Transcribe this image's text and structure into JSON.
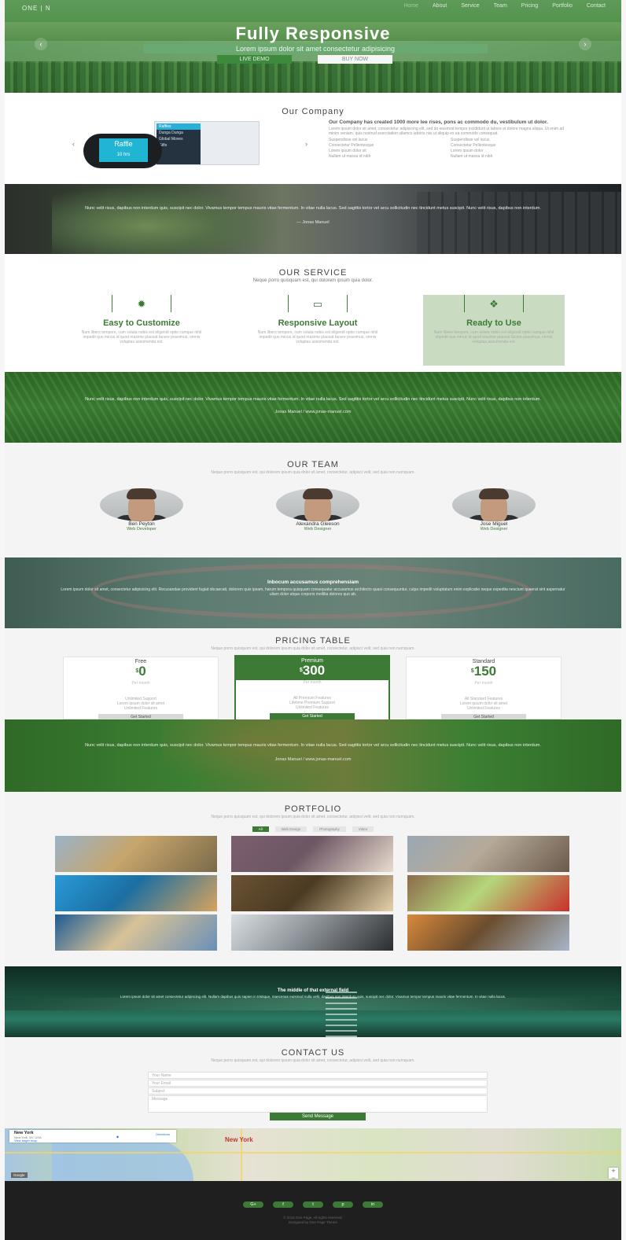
{
  "nav": {
    "brand": "ONE | N",
    "items": [
      "Home",
      "About",
      "Service",
      "Team",
      "Pricing",
      "Portfolio",
      "Contact"
    ],
    "active_index": 0
  },
  "hero": {
    "title": "Fully Responsive",
    "subtitle": "Lorem ipsum dolor sit amet consectetur adipisicing",
    "btn_demo": "LIVE DEMO",
    "btn_buy": "BUY NOW",
    "prev_icon": "‹",
    "next_icon": "›"
  },
  "company": {
    "title": "Our Company",
    "heading": "Our Company has created 1000 more lee rises, pons ac commodo du, vestibulum ut dolor.",
    "body": "Lorem ipsum dolor sit amet, consectetur adipisicing elit, sed do eiusmod tempor incididunt ut labore et dolore magna aliqua. Ut enim ad minim veniam, quis nostrud exercitation ullamco laboris nisi ut aliquip ex ea commodo consequat.",
    "list": [
      "Suspendisse vel lacus",
      "Suspendisse vel lacus",
      "Consectetur Pellentesque",
      "Consectetur Pellentesque",
      "Lorem ipsum dolor sit",
      "Lorem ipsum dolor",
      "Nullam ut massa id nibh",
      "Nullam ut massa id nibh"
    ],
    "phone_menu": [
      "Raffles",
      "Dunga Dunga",
      "Global Moves",
      "Gifts"
    ],
    "watch_label": "Raffle",
    "watch_sub": "10 hrs",
    "prev": "‹",
    "next": "›"
  },
  "quote1": {
    "text": "Nunc velit risus, dapibus non interdum quis, suscipit nec dolor. Vivamus tempor tempus mauris vitae fermentum. In vitae nulla lacus. Sed sagittis tortor vel arcu sollicitudin nec tincidunt metus suscipit. Nunc velit risus, dapibus non interdum.",
    "author": "— Jonas Manuel"
  },
  "service": {
    "title": "OUR SERVICE",
    "subtitle": "Neque porro quisquam est, qui dolorem ipsum quia dolor.",
    "items": [
      {
        "icon": "gear-icon",
        "glyph": "✹",
        "title": "Easy to Customize",
        "text": "Nam libero tempore, cum soluta nobis est eligendi optio cumque nihil impedit quo minus id quod maxime placeat facere possimus, omnis voluptas assumenda est."
      },
      {
        "icon": "monitor-icon",
        "glyph": "▭",
        "title": "Responsive Layout",
        "text": "Nam libero tempore, cum soluta nobis est eligendi optio cumque nihil impedit quo minus id quod maxime placeat facere possimus, omnis voluptas assumenda est."
      },
      {
        "icon": "dropbox-icon",
        "glyph": "❖",
        "title": "Ready to Use",
        "text": "Nam libero tempore, cum soluta nobis est eligendi optio cumque nihil impedit quo minus id quod maxime placeat facere possimus, omnis voluptas assumenda est."
      }
    ]
  },
  "quote2": {
    "text": "Nunc velit risus, dapibus non interdum quis, suscipit nec dolor. Vivamus tempor tempus mauris vitae fermentum. In vitae nulla lacus. Sed sagittis tortor vel arcu sollicitudin nec tincidunt metus suscipit. Nunc velit risus, dapibus non interdum.",
    "author": "Jonas Manuel / www.jonas-manuel.com"
  },
  "team": {
    "title": "OUR TEAM",
    "subtitle": "Neque porro quisquam est, qui dolorem ipsum quia dolor sit amet, consectetur, adipisci velit, sed quia non numquam.",
    "members": [
      {
        "name": "Ben Peyton",
        "role": "Web Developer"
      },
      {
        "name": "Alexandra Gleeson",
        "role": "Web Designer"
      },
      {
        "name": "Jose Miguel",
        "role": "Web Designer"
      }
    ]
  },
  "info": {
    "title": "Inbocum accusamus comprehensiam",
    "text": "Lorem ipsum dolor sit amet, consectetur adipisicing elit. Recusandae provident fugiat obcaecati, dolorem quis ipsam, harum tempora quisquam consequatur accusamus architecto quasi consequuntur, culpa impedit voluptatum enim explicabo neque expedita nesciunt quaerat sint aspernatur ullam dolor atque corporis mollitia dolores quo ab."
  },
  "pricing": {
    "title": "PRICING TABLE",
    "subtitle": "Neque porro quisquam est, qui dolorem ipsum quia dolor sit amet, consectetur, adipisci velit, sed quia non numquam.",
    "currency": "$",
    "plans": [
      {
        "name": "Free",
        "price": "0",
        "desc": "Per month",
        "features": "Unlimited Support\nLorem ipsum dolor sit amet\nUnlimited Features",
        "button": "Get Started",
        "featured": false
      },
      {
        "name": "Premium",
        "price": "300",
        "desc": "Per month",
        "features": "All Premium Features\nLifetime Premium Support\nUnlimited Features",
        "button": "Get Started",
        "featured": true
      },
      {
        "name": "Standard",
        "price": "150",
        "desc": "Per month",
        "features": "All Standard Features\nLorem ipsum dolor sit amet\nUnlimited Features",
        "button": "Get Started",
        "featured": false
      }
    ]
  },
  "quote3": {
    "text": "Nunc velit risus, dapibus non interdum quis, suscipit nec dolor. Vivamus tempor tempus mauris vitae fermentum. In vitae nulla lacus. Sed sagittis tortor vel arcu sollicitudin nec tincidunt metus suscipit. Nunc velit risus, dapibus non interdum.",
    "author": "Jonas Manuel / www.jonas-manuel.com"
  },
  "portfolio": {
    "title": "PORTFOLIO",
    "subtitle": "Neque porro quisquam est, qui dolorem ipsum quia dolor sit amet, consectetur, adipisci velit, sed quia non numquam.",
    "filters": [
      "All",
      "Web Design",
      "Photography",
      "Video"
    ],
    "active_filter": 0,
    "thumbs": [
      "dogs-running",
      "laptop-coffee",
      "railway-tracks",
      "runner-legs",
      "truss-bridge",
      "vegetables-plate",
      "stadium-stairs",
      "keyboard-closeup",
      "countryside-house"
    ],
    "thumb_colors": [
      [
        "#9ab3c9",
        "#7a6a4a",
        "#c7a56b"
      ],
      [
        "#7b5f6e",
        "#e8dccd",
        "#6d5664"
      ],
      [
        "#9aa8b3",
        "#6b5a4b",
        "#b6aa99"
      ],
      [
        "#2a9ad8",
        "#d8a35e",
        "#1b6fa3"
      ],
      [
        "#6b5334",
        "#e6d2aa",
        "#4b3a22"
      ],
      [
        "#8c6a4b",
        "#c9302c",
        "#b5d67a"
      ],
      [
        "#1f5b94",
        "#6a8fb7",
        "#d9c397"
      ],
      [
        "#d9dee2",
        "#2b2d2f",
        "#8f959a"
      ],
      [
        "#d9893b",
        "#a6b6c8",
        "#6b4d2e"
      ]
    ]
  },
  "dock": {
    "title": "The middle of that external field",
    "text": "Lorem ipsum dolor sit amet consectetur adipiscing elit. Nullam dapibus quis sapien in tristique, maecenas euismod nulla velit, dapibus non interdum quis, suscipit nec dolor. Vivamus tempor tempus mauris vitae fermentum. In vitae nulla lacus."
  },
  "contact": {
    "title": "CONTACT US",
    "subtitle": "Neque porro quisquam est, qui dolorem ipsum quia dolor sit amet, consectetur, adipisci velit, sed quia non numquam.",
    "name_placeholder": "Your Name",
    "email_placeholder": "Your Email",
    "subject_placeholder": "Subject",
    "message_placeholder": "Message",
    "send": "Send Message"
  },
  "map": {
    "place": "New York",
    "place_sub": "New York, NY, USA",
    "view_larger": "View larger map",
    "directions": "Directions",
    "city_label": "New York",
    "zoom_in": "+",
    "zoom_out": "−",
    "google": "Google"
  },
  "footer": {
    "socials": [
      "G+",
      "f",
      "t",
      "p",
      "in"
    ],
    "copyright": "© 2016 One Page. All rights reserved.",
    "credit": "Designed by One Page Theme"
  }
}
